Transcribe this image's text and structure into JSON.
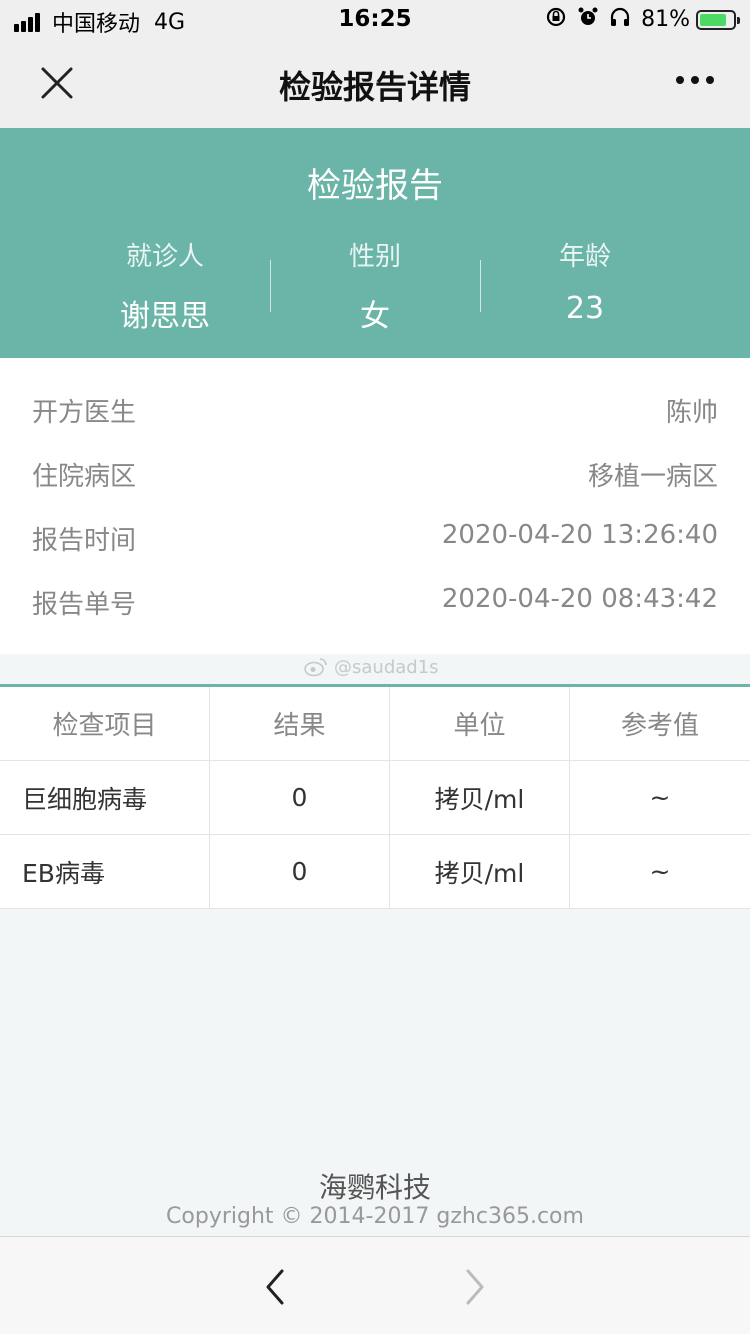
{
  "status_bar": {
    "carrier": "中国移动",
    "network": "4G",
    "time": "16:25",
    "battery_percent": "81%",
    "battery_level": 0.81
  },
  "nav": {
    "title": "检验报告详情"
  },
  "header": {
    "title": "检验报告",
    "patient_label": "就诊人",
    "patient_value": "谢思思",
    "gender_label": "性别",
    "gender_value": "女",
    "age_label": "年龄",
    "age_value": "23"
  },
  "info": {
    "rows": [
      {
        "label": "开方医生",
        "value": "陈帅"
      },
      {
        "label": "住院病区",
        "value": "移植一病区"
      },
      {
        "label": "报告时间",
        "value": "2020-04-20 13:26:40"
      },
      {
        "label": "报告单号",
        "value": "2020-04-20 08:43:42"
      }
    ]
  },
  "watermark": "@saudad1s",
  "table": {
    "headers": [
      "检查项目",
      "结果",
      "单位",
      "参考值"
    ],
    "rows": [
      [
        "巨细胞病毒",
        "0",
        "拷贝/ml",
        "~"
      ],
      [
        "EB病毒",
        "0",
        "拷贝/ml",
        "~"
      ]
    ]
  },
  "footer": {
    "company": "海鹦科技",
    "copyright": "Copyright © 2014-2017 gzhc365.com"
  },
  "colors": {
    "accent": "#6ab4a8",
    "background": "#f2f6f6"
  }
}
